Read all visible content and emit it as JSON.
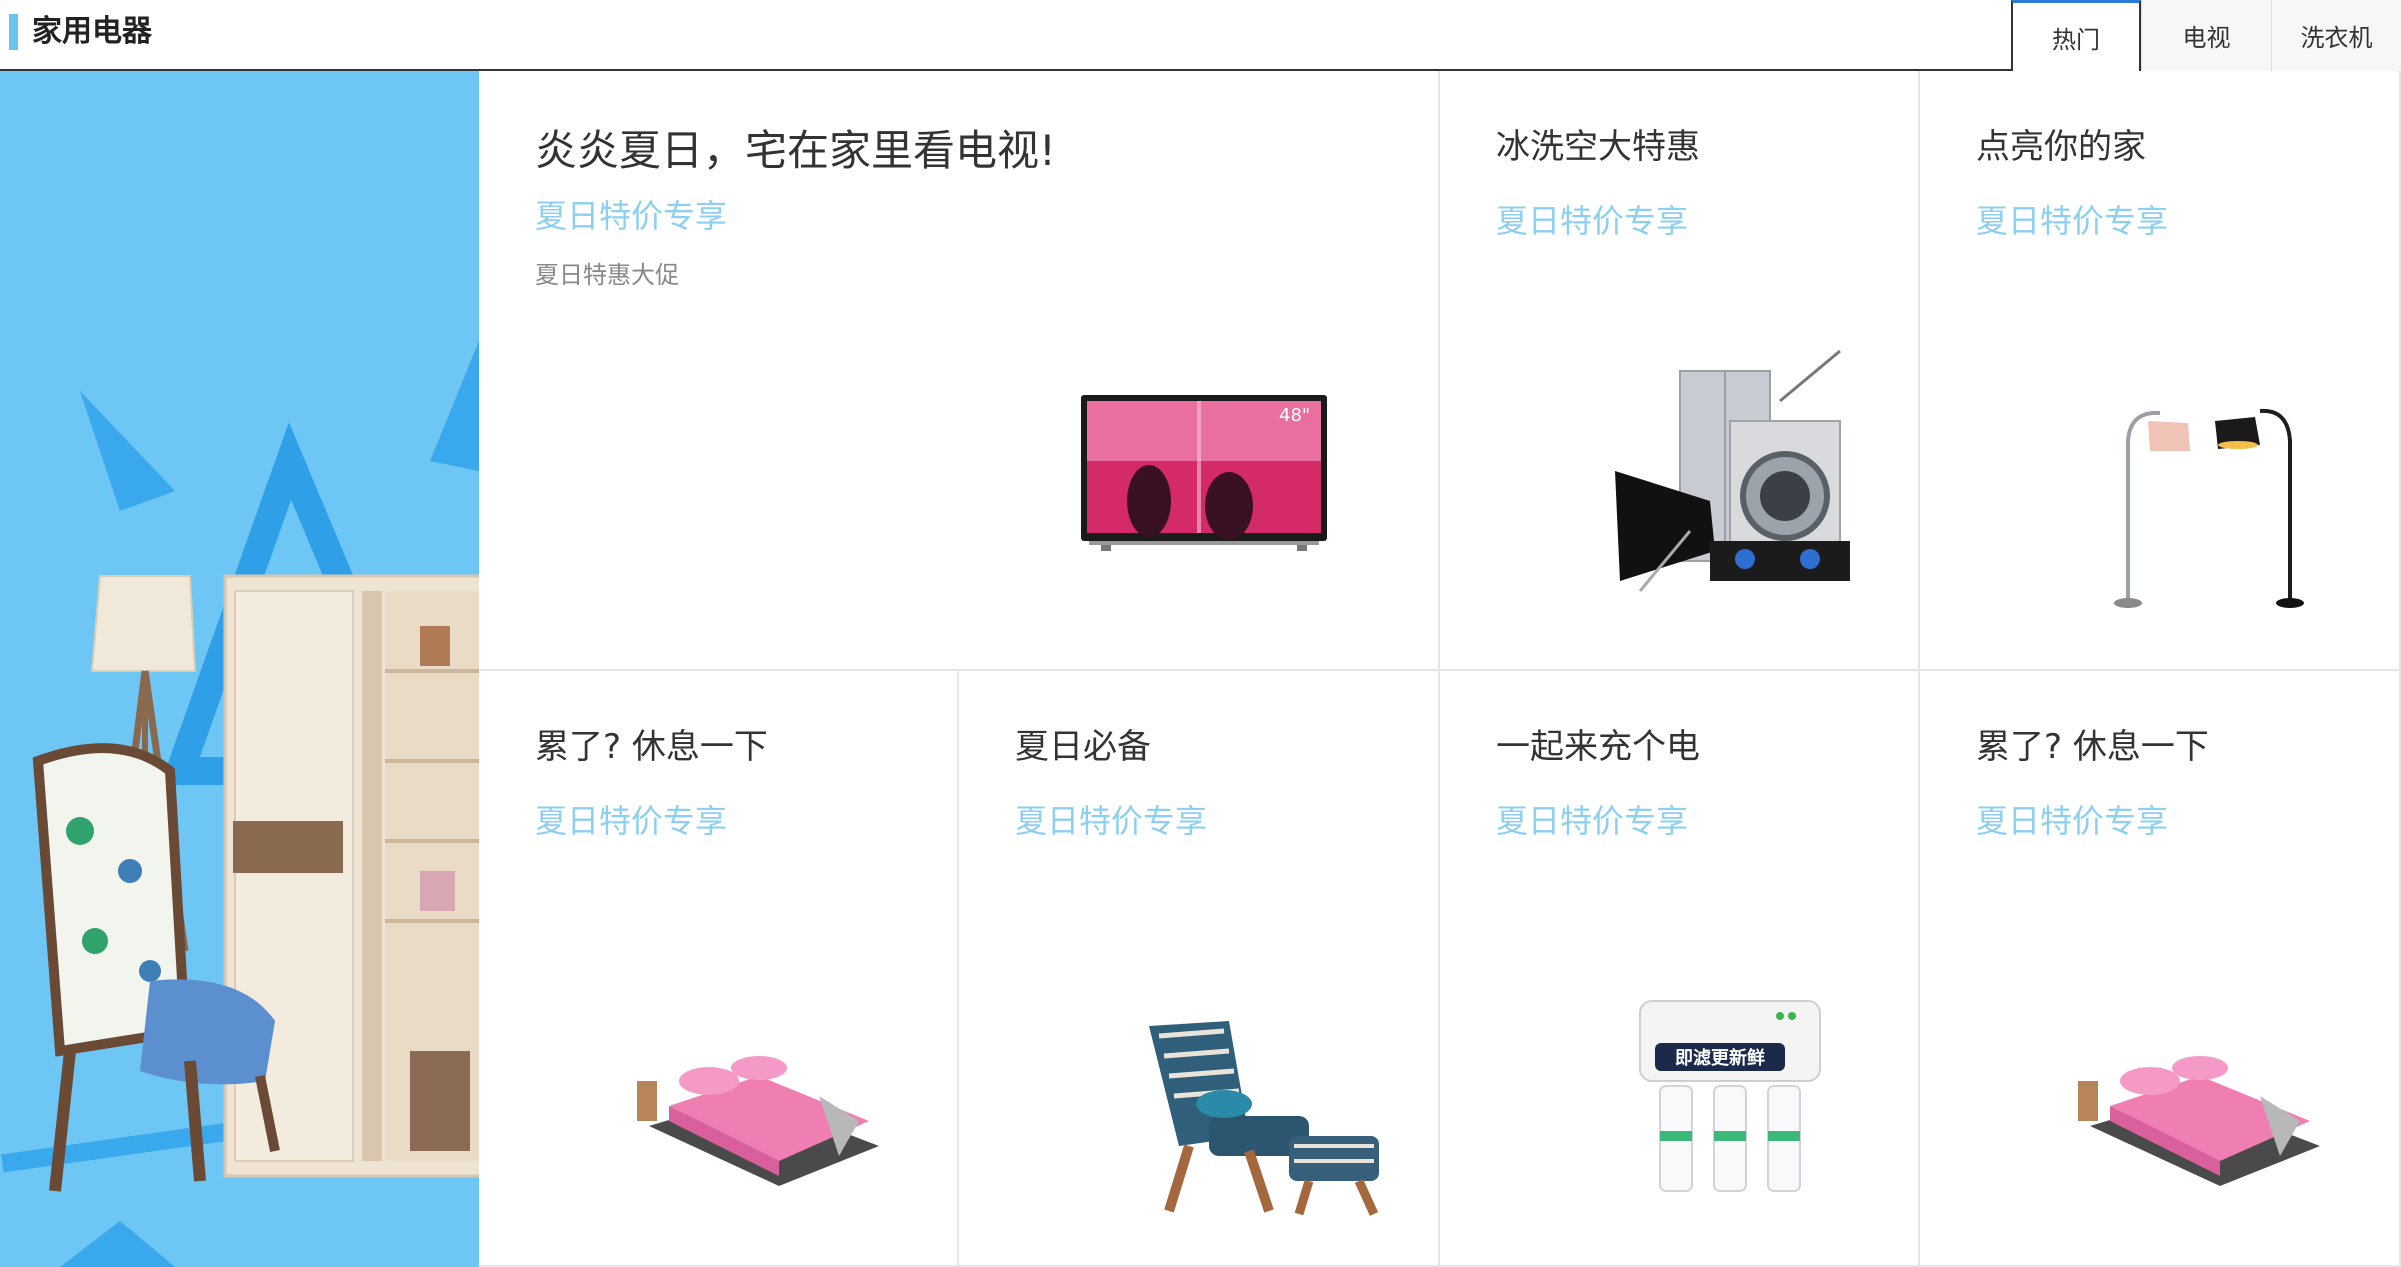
{
  "section": {
    "title": "家用电器",
    "accent_color": "#6cc3f2"
  },
  "tabs": [
    {
      "label": "热门",
      "active": true
    },
    {
      "label": "电视",
      "active": false
    },
    {
      "label": "洗衣机",
      "active": false
    }
  ],
  "hero": {
    "background_color": "#6ec6f4",
    "image": "chair-lamp-wardrobe-illustration"
  },
  "promo_main": {
    "title": "炎炎夏日，宅在家里看电视!",
    "subtitle": "夏日特价专享",
    "description": "夏日特惠大促",
    "image": "tv-icon"
  },
  "promos": [
    {
      "title": "冰洗空大特惠",
      "subtitle": "夏日特价专享",
      "image": "appliances-icon"
    },
    {
      "title": "点亮你的家",
      "subtitle": "夏日特价专享",
      "image": "floor-lamp-icon"
    },
    {
      "title": "累了? 休息一下",
      "subtitle": "夏日特价专享",
      "image": "bed-icon"
    },
    {
      "title": "夏日必备",
      "subtitle": "夏日特价专享",
      "image": "lounge-chair-icon"
    },
    {
      "title": "一起来充个电",
      "subtitle": "夏日特价专享",
      "image": "water-purifier-icon"
    },
    {
      "title": "累了? 休息一下",
      "subtitle": "夏日特价专享",
      "image": "bed-icon"
    }
  ],
  "tv_badge": "48\"",
  "purifier_label": "即滤更新鲜",
  "colors": {
    "subtitle": "#8ccff0",
    "tab_active_border": "#2b7bd6",
    "divider": "#e6e6e6"
  }
}
